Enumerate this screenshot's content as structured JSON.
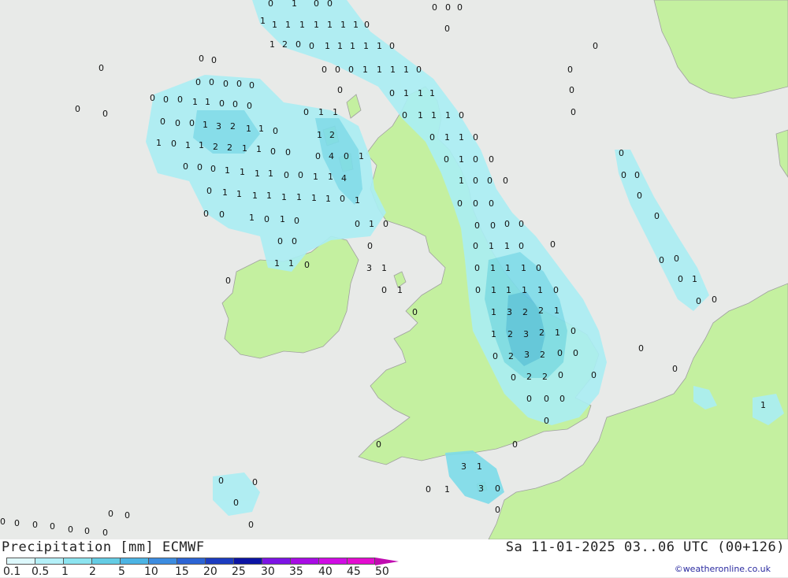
{
  "map": {
    "colors": {
      "sea": "#e8eae8",
      "land": "#c4f0a0",
      "border": "#a0a0a0",
      "precip_light": "#aaeef4",
      "precip_mid": "#7ddcea",
      "precip_heavy": "#5cc4e0"
    },
    "value_labels": [
      "0",
      "1",
      "2",
      "3",
      "4"
    ]
  },
  "footer": {
    "title_left": "Precipitation [mm] ECMWF",
    "title_right": "Sa 11-01-2025 03..06 UTC (00+126)",
    "credit": "©weatheronline.co.uk",
    "legend": {
      "labels": [
        "0.1",
        "0.5",
        "1",
        "2",
        "5",
        "10",
        "15",
        "20",
        "25",
        "30",
        "35",
        "40",
        "45",
        "50"
      ],
      "colors": [
        "#ddf8fc",
        "#b4f0f8",
        "#8ce4f0",
        "#64cce4",
        "#4cb4e4",
        "#3c8ce0",
        "#2c64d4",
        "#1c3cc0",
        "#0c14a4",
        "#7c14e4",
        "#a80ce4",
        "#d00ce4",
        "#e40cd0",
        "#c00cb0"
      ]
    }
  }
}
